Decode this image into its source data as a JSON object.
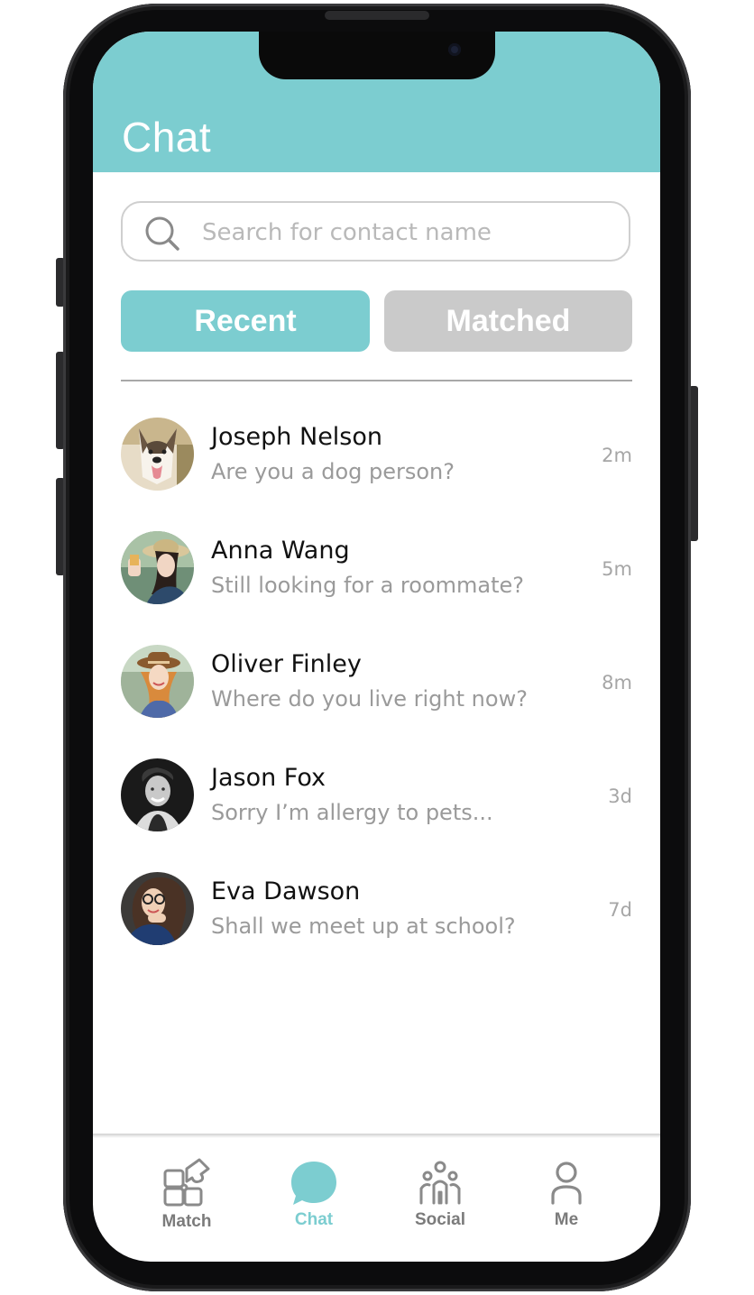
{
  "header": {
    "title": "Chat"
  },
  "search": {
    "placeholder": "Search for contact name",
    "value": ""
  },
  "tabs": [
    {
      "label": "Recent",
      "active": true
    },
    {
      "label": "Matched",
      "active": false
    }
  ],
  "chats": [
    {
      "name": "Joseph Nelson",
      "message": "Are you a dog person?",
      "time": "2m",
      "avatar": "dog-photo"
    },
    {
      "name": "Anna Wang",
      "message": "Still looking for a roommate?",
      "time": "5m",
      "avatar": "woman-hat-photo"
    },
    {
      "name": "Oliver Finley",
      "message": "Where do you live right now?",
      "time": "8m",
      "avatar": "woman-hat-smiling-photo"
    },
    {
      "name": "Jason Fox",
      "message": "Sorry I’m allergy to pets...",
      "time": "3d",
      "avatar": "man-bw-photo"
    },
    {
      "name": "Eva Dawson",
      "message": "Shall we meet up at school?",
      "time": "7d",
      "avatar": "woman-glasses-photo"
    }
  ],
  "nav": [
    {
      "label": "Match",
      "icon": "puzzle-icon",
      "active": false
    },
    {
      "label": "Chat",
      "icon": "chat-bubble-icon",
      "active": true
    },
    {
      "label": "Social",
      "icon": "people-icon",
      "active": false
    },
    {
      "label": "Me",
      "icon": "person-icon",
      "active": false
    }
  ],
  "colors": {
    "accent": "#7ccdd0",
    "inactive_tab": "#cacaca",
    "nav_inactive": "#7b7b7b"
  }
}
